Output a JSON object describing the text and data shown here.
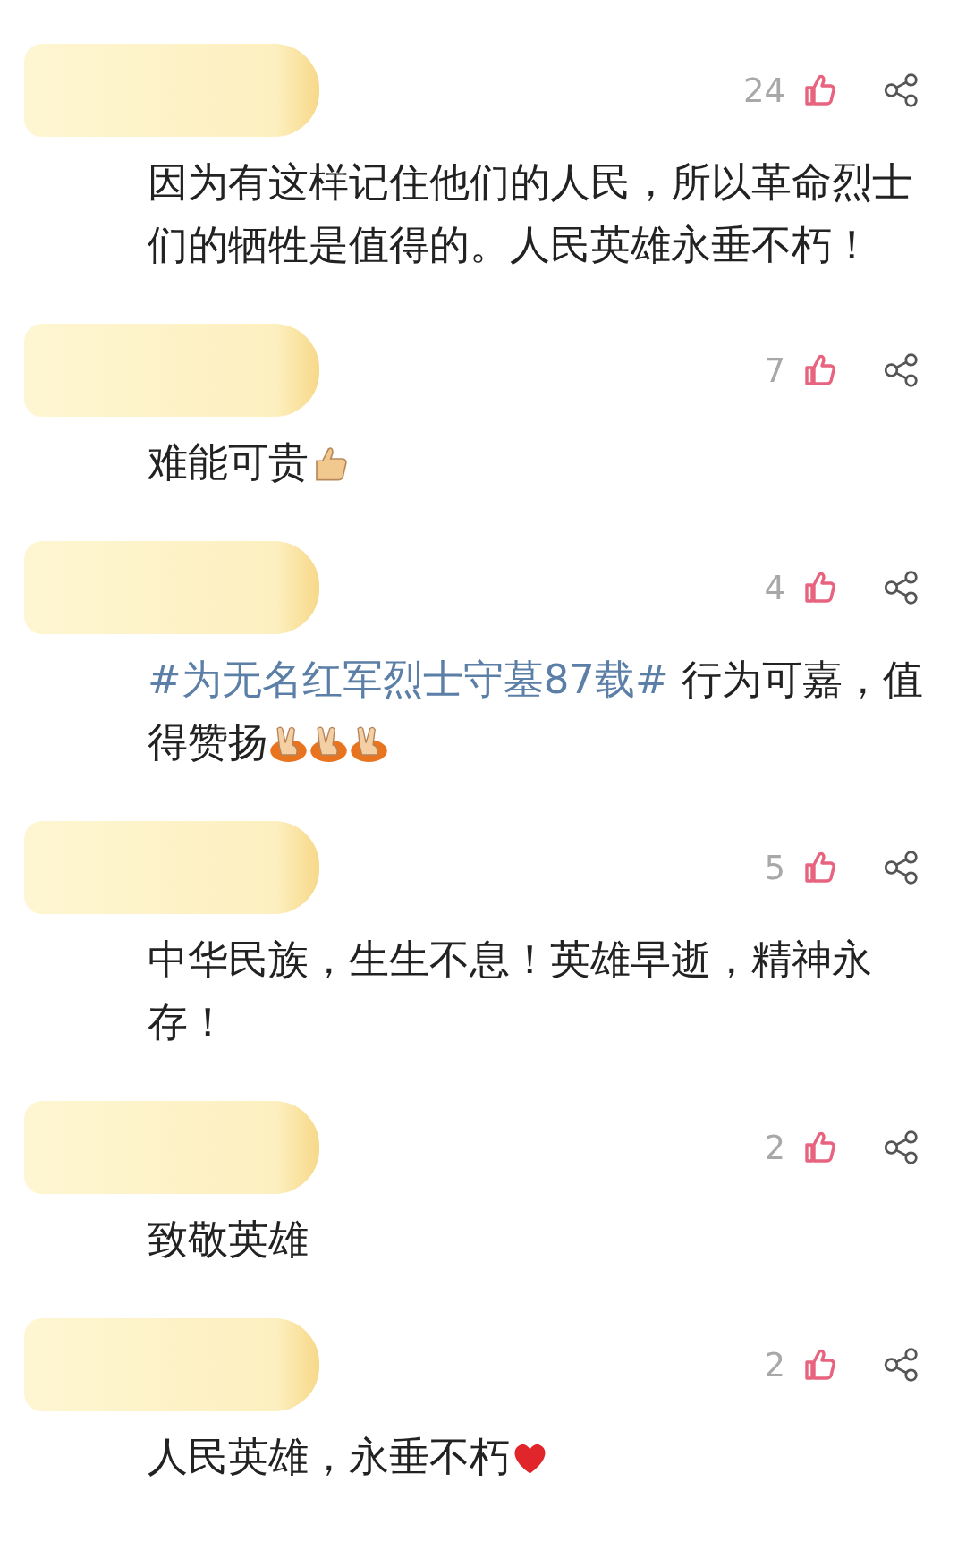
{
  "comments": [
    {
      "likes": "24",
      "lines": [
        {
          "text": "因为有这样记住他们的人民，所以革命烈士"
        },
        {
          "text": "们的牺牲是值得的。人民英雄永垂不朽！"
        }
      ]
    },
    {
      "likes": "7",
      "lines": [
        {
          "text": "难能可贵",
          "emoji": [
            {
              "kind": "thumbs-up"
            }
          ]
        }
      ]
    },
    {
      "likes": "4",
      "lines": [
        {
          "hashtag": "#为无名红军烈士守墓87载#",
          "text": " 行为可嘉，值"
        },
        {
          "text": "得赞扬",
          "emoji": [
            {
              "kind": "victory-hand"
            },
            {
              "kind": "victory-hand"
            },
            {
              "kind": "victory-hand"
            }
          ]
        }
      ]
    },
    {
      "likes": "5",
      "lines": [
        {
          "text": "中华民族，生生不息！英雄早逝，精神永"
        },
        {
          "text": "存！"
        }
      ]
    },
    {
      "likes": "2",
      "lines": [
        {
          "text": "致敬英雄"
        }
      ]
    },
    {
      "likes": "2",
      "lines": [
        {
          "text": "人民英雄，永垂不朽",
          "emoji": [
            {
              "kind": "heart"
            }
          ]
        }
      ]
    }
  ]
}
